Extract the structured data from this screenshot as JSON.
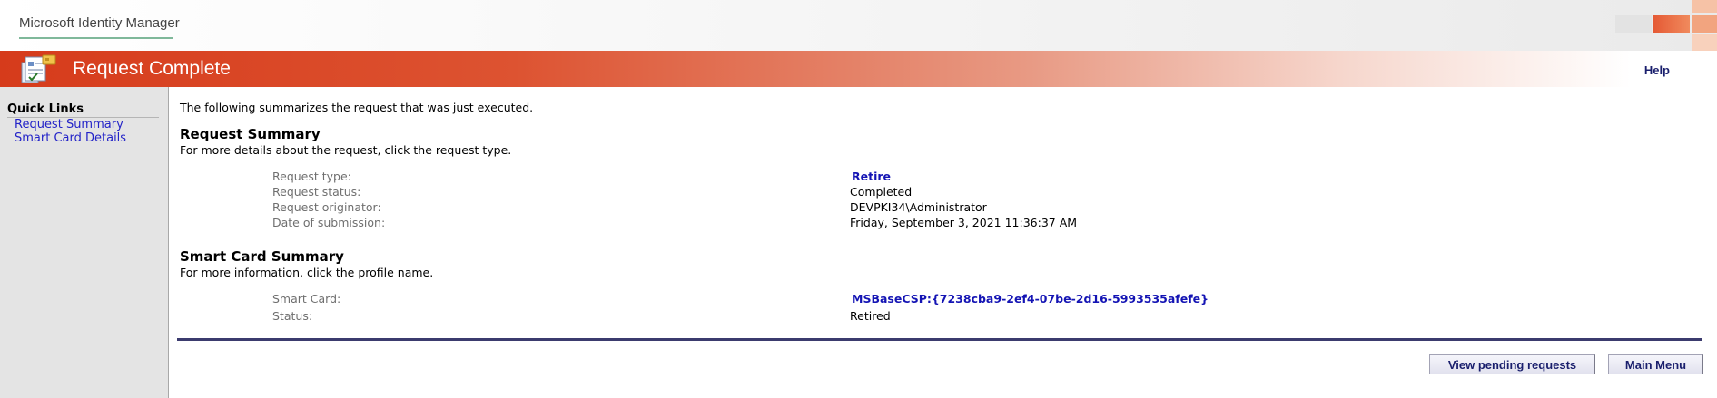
{
  "header": {
    "brand": "Microsoft Identity Manager",
    "page_title": "Request Complete",
    "help_label": "Help"
  },
  "sidebar": {
    "title": "Quick Links",
    "items": [
      {
        "label": "Request Summary"
      },
      {
        "label": "Smart Card Details"
      }
    ]
  },
  "main": {
    "intro": "The following summarizes the request that was just executed.",
    "request_summary": {
      "title": "Request Summary",
      "subtitle": "For more details about the request, click the request type.",
      "rows": [
        {
          "label": "Request type:",
          "value": "Retire"
        },
        {
          "label": "Request status:",
          "value": "Completed"
        },
        {
          "label": "Request originator:",
          "value": "DEVPKI34\\Administrator"
        },
        {
          "label": "Date of submission:",
          "value": "Friday, September 3, 2021 11:36:37 AM"
        }
      ]
    },
    "smart_card_summary": {
      "title": "Smart Card Summary",
      "subtitle": "For more information, click the profile name.",
      "rows": [
        {
          "label": "Smart Card:",
          "value": "MSBaseCSP:{7238cba9-2ef4-07be-2d16-5993535afefe}"
        },
        {
          "label": "Status:",
          "value": "Retired"
        }
      ]
    },
    "buttons": {
      "view_pending": "View pending requests",
      "main_menu": "Main Menu"
    }
  },
  "colors": {
    "accent": "#d63b1b",
    "link": "#1414b4",
    "nav_link": "#2323c8",
    "button_text": "#1a1f6d"
  }
}
